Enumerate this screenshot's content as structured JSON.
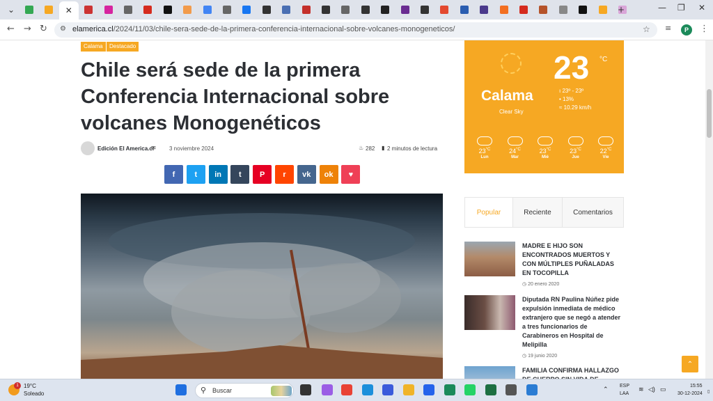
{
  "browser": {
    "tabs": [
      {
        "icon": "plus-green-icon",
        "color": "#34a853"
      },
      {
        "icon": "orange-site-icon",
        "color": "#f6a823"
      },
      {
        "icon": "close-icon",
        "active": true
      },
      {
        "icon": "doc-icon",
        "color": "#c33"
      },
      {
        "icon": "instagram-icon",
        "color": "#d6249f"
      },
      {
        "icon": "globe-icon",
        "color": "#666"
      },
      {
        "icon": "chile-flag-icon",
        "color": "#d52b1e"
      },
      {
        "icon": "tv-icon",
        "color": "#111"
      },
      {
        "icon": "orange-site-icon",
        "color": "#f29b4b"
      },
      {
        "icon": "google-icon",
        "color": "#4285f4"
      },
      {
        "icon": "globe-icon",
        "color": "#666"
      },
      {
        "icon": "facebook-icon",
        "color": "#1877f2"
      },
      {
        "icon": "t-icon",
        "color": "#333"
      },
      {
        "icon": "news-icon",
        "color": "#4a6fb3"
      },
      {
        "icon": "lt-icon",
        "color": "#c4302b"
      },
      {
        "icon": "pen-icon",
        "color": "#333"
      },
      {
        "icon": "globe-icon",
        "color": "#666"
      },
      {
        "icon": "pen-icon",
        "color": "#333"
      },
      {
        "icon": "tv-icon",
        "color": "#222"
      },
      {
        "icon": "news-icon",
        "color": "#6a2c91"
      },
      {
        "icon": "pen-icon",
        "color": "#333"
      },
      {
        "icon": "orange-site-icon",
        "color": "#e3492f"
      },
      {
        "icon": "news-icon",
        "color": "#2a5db0"
      },
      {
        "icon": "news-icon",
        "color": "#4b3a8c"
      },
      {
        "icon": "tb-icon",
        "color": "#f36f21"
      },
      {
        "icon": "chile-flag-icon",
        "color": "#d52b1e"
      },
      {
        "icon": "mountain-icon",
        "color": "#b5532a"
      },
      {
        "icon": "cloud-icon",
        "color": "#888"
      },
      {
        "icon": "news-icon",
        "color": "#111"
      },
      {
        "icon": "grid-icon",
        "color": "#f6a823"
      },
      {
        "icon": "news-icon",
        "color": "#d9a6d8"
      }
    ],
    "new_tab": "+",
    "window_controls": {
      "minimize": "—",
      "restore": "❐",
      "close": "✕"
    },
    "url_host": "elamerica.cl",
    "url_path": "/2024/11/03/chile-sera-sede-de-la-primera-conferencia-internacional-sobre-volcanes-monogeneticos/",
    "profile_initial": "P"
  },
  "article": {
    "tags": [
      "Calama",
      "Destacado"
    ],
    "title": "Chile será sede de la primera Conferencia Internacional sobre volcanes Monogenéticos",
    "author": "Edición El America.cl",
    "date": "3 noviembre 2024",
    "views": "282",
    "read_time": "2 minutos de lectura",
    "share": [
      {
        "label": "f",
        "name": "facebook",
        "color": "#4267b2"
      },
      {
        "label": "t",
        "name": "twitter",
        "color": "#1da1f2"
      },
      {
        "label": "in",
        "name": "linkedin",
        "color": "#0077b5"
      },
      {
        "label": "t",
        "name": "tumblr",
        "color": "#35465c"
      },
      {
        "label": "P",
        "name": "pinterest",
        "color": "#e60023"
      },
      {
        "label": "r",
        "name": "reddit",
        "color": "#ff4500"
      },
      {
        "label": "vk",
        "name": "vk",
        "color": "#45668e"
      },
      {
        "label": "ok",
        "name": "odnoklassniki",
        "color": "#ee8208"
      },
      {
        "label": "♥",
        "name": "pocket",
        "color": "#ef4056"
      }
    ]
  },
  "weather": {
    "city": "Calama",
    "sky": "Clear Sky",
    "temp": "23",
    "unit": "°C",
    "range": "23º - 23º",
    "humidity": "13%",
    "wind": "10.29 km/h",
    "forecast": [
      {
        "temp": "23",
        "day": "Lun"
      },
      {
        "temp": "24",
        "day": "Mar"
      },
      {
        "temp": "23",
        "day": "Mié"
      },
      {
        "temp": "23",
        "day": "Jue"
      },
      {
        "temp": "22",
        "day": "Vie"
      }
    ],
    "forecast_unit": "°C"
  },
  "sidebar_tabs": [
    "Popular",
    "Reciente",
    "Comentarios"
  ],
  "posts": [
    {
      "title": "MADRE E HIJO SON ENCONTRADOS MUERTOS Y CON MÚLTIPLES PUÑALADAS EN TOCOPILLA",
      "date": "20 enero 2020"
    },
    {
      "title": "Diputada RN Paulina Núñez pide expulsión inmediata de médico extranjero que se negó a atender a tres funcionarios de Carabineros en Hospital de Melipilla",
      "date": "19 junio 2020"
    },
    {
      "title": "FAMILIA CONFIRMA HALLAZGO DE CUERPO SIN VIDA DE",
      "date": ""
    }
  ],
  "taskbar": {
    "weather_temp": "19°C",
    "weather_desc": "Soleado",
    "weather_badge": "1",
    "search_label": "Buscar",
    "lang_top": "ESP",
    "lang_bottom": "LAA",
    "time": "15:55",
    "date": "30-12-2024",
    "apps": [
      {
        "name": "start-icon",
        "color": "#1f6fe0"
      },
      {
        "name": "task-view-icon",
        "color": "#333"
      },
      {
        "name": "copilot-icon",
        "color": "#9b5de5"
      },
      {
        "name": "chrome-icon",
        "color": "#e94235"
      },
      {
        "name": "edge-icon",
        "color": "#1c8fdb"
      },
      {
        "name": "app-q-icon",
        "color": "#3b5bdb"
      },
      {
        "name": "file-explorer-icon",
        "color": "#f0b429"
      },
      {
        "name": "store-icon",
        "color": "#2563eb"
      },
      {
        "name": "chrome-profile-icon",
        "color": "#1b8a5a"
      },
      {
        "name": "whatsapp-icon",
        "color": "#25d366"
      },
      {
        "name": "excel-icon",
        "color": "#1d6f42"
      },
      {
        "name": "calculator-icon",
        "color": "#555"
      },
      {
        "name": "app-generic-icon",
        "color": "#2b7cd3"
      }
    ]
  }
}
